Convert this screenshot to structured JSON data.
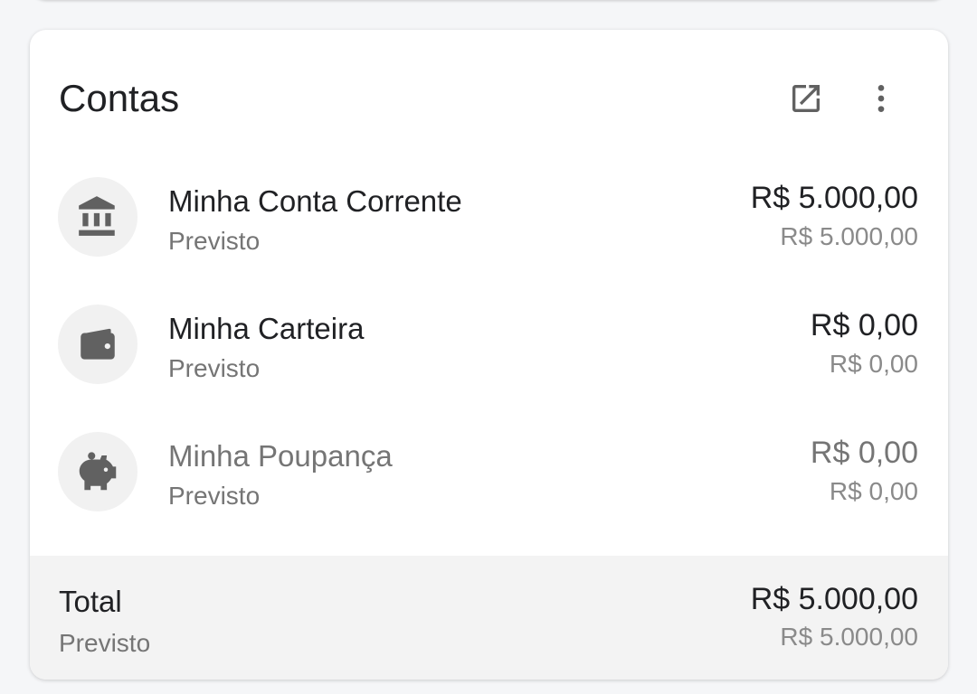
{
  "card": {
    "title": "Contas",
    "open_icon": "open-in-new-icon",
    "more_icon": "more-vert-icon"
  },
  "accounts": [
    {
      "icon": "bank-icon",
      "name": "Minha Conta Corrente",
      "subtitle": "Previsto",
      "balance": "R$ 5.000,00",
      "forecast": "R$ 5.000,00"
    },
    {
      "icon": "wallet-icon",
      "name": "Minha Carteira",
      "subtitle": "Previsto",
      "balance": "R$ 0,00",
      "forecast": "R$ 0,00"
    },
    {
      "icon": "piggy-bank-icon",
      "name": "Minha Poupança",
      "subtitle": "Previsto",
      "balance": "R$ 0,00",
      "forecast": "R$ 0,00"
    }
  ],
  "total": {
    "label": "Total",
    "subtitle": "Previsto",
    "balance": "R$ 5.000,00",
    "forecast": "R$ 5.000,00"
  },
  "colors": {
    "background": "#f5f6f8",
    "card": "#ffffff",
    "footer": "#f3f3f3",
    "icon": "#616161",
    "text_primary": "#202124",
    "text_secondary": "#757575"
  }
}
